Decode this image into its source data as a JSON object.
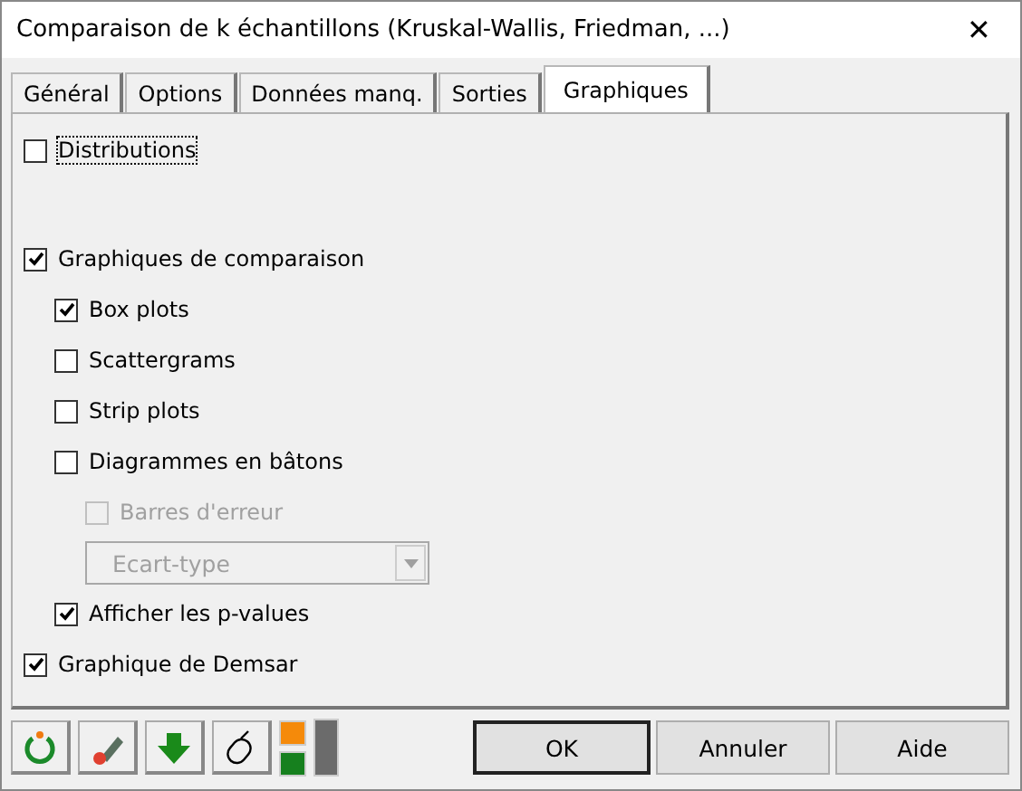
{
  "window": {
    "title": "Comparaison de k échantillons (Kruskal-Wallis, Friedman, ...)",
    "close": "✕"
  },
  "tabs": [
    {
      "label": "Général",
      "selected": false
    },
    {
      "label": "Options",
      "selected": false
    },
    {
      "label": "Données manq.",
      "selected": false
    },
    {
      "label": "Sorties",
      "selected": false
    },
    {
      "label": "Graphiques",
      "selected": true
    }
  ],
  "options": [
    {
      "kind": "checkbox",
      "label": "Distributions",
      "checked": false,
      "disabled": false,
      "focused": true
    },
    {
      "kind": "checkbox",
      "label": "Graphiques de comparaison",
      "checked": true,
      "disabled": false,
      "focused": false,
      "children": [
        {
          "kind": "checkbox",
          "label": "Box plots",
          "checked": true,
          "disabled": false,
          "focused": false
        },
        {
          "kind": "checkbox",
          "label": "Scattergrams",
          "checked": false,
          "disabled": false,
          "focused": false
        },
        {
          "kind": "checkbox",
          "label": "Strip plots",
          "checked": false,
          "disabled": false,
          "focused": false
        },
        {
          "kind": "checkbox",
          "label": "Diagrammes en bâtons",
          "checked": false,
          "disabled": false,
          "focused": false,
          "children": [
            {
              "kind": "checkbox",
              "label": "Barres d'erreur",
              "checked": false,
              "disabled": true,
              "focused": false
            },
            {
              "kind": "dropdown",
              "value": "Ecart-type",
              "disabled": true
            }
          ]
        },
        {
          "kind": "checkbox",
          "label": "Afficher les p-values",
          "checked": true,
          "disabled": false,
          "focused": false
        }
      ]
    },
    {
      "kind": "checkbox",
      "label": "Graphique de Demsar",
      "checked": true,
      "disabled": false,
      "focused": false
    }
  ],
  "toolbar": [
    {
      "kind": "reset"
    },
    {
      "kind": "eraser"
    },
    {
      "kind": "download"
    },
    {
      "kind": "mouse"
    },
    {
      "kind": "colors"
    },
    {
      "kind": "bar"
    }
  ],
  "buttons": [
    "OK",
    "Annuler",
    "Aide"
  ]
}
